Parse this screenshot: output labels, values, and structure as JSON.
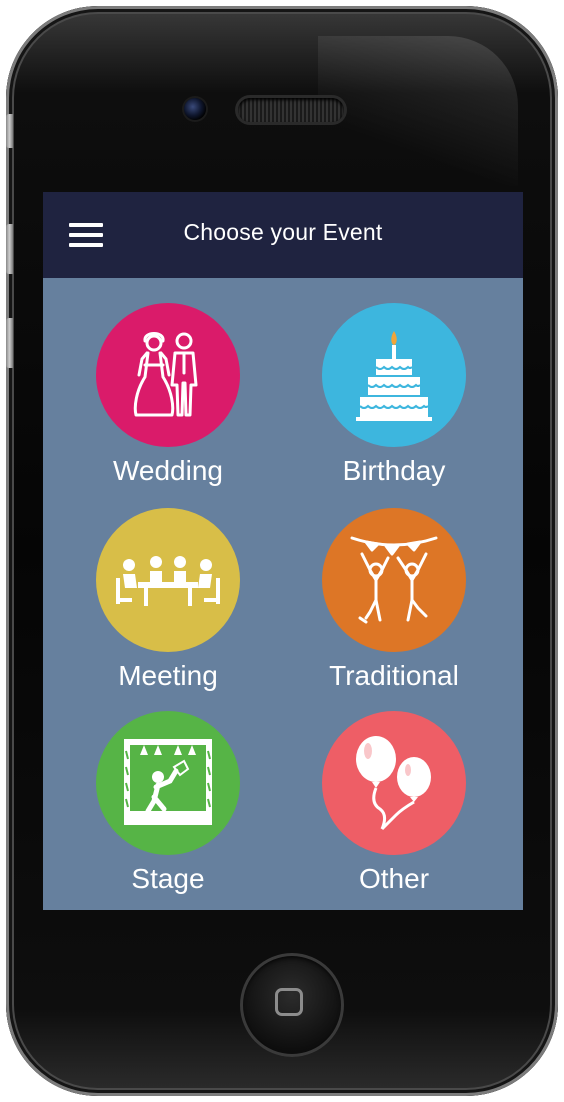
{
  "header": {
    "title": "Choose your Event",
    "menu_icon": "hamburger-menu-icon"
  },
  "events": [
    {
      "label": "Wedding",
      "icon": "wedding-couple-icon",
      "color": "#da1b6a"
    },
    {
      "label": "Birthday",
      "icon": "birthday-cake-icon",
      "color": "#3db6de"
    },
    {
      "label": "Meeting",
      "icon": "meeting-table-icon",
      "color": "#d8be48"
    },
    {
      "label": "Traditional",
      "icon": "traditional-dance-icon",
      "color": "#dd7626"
    },
    {
      "label": "Stage",
      "icon": "stage-performer-icon",
      "color": "#56b446"
    },
    {
      "label": "Other",
      "icon": "balloons-icon",
      "color": "#ee5e66"
    }
  ],
  "colors": {
    "header_bg": "#1f2340",
    "screen_bg": "#66809e",
    "text": "#ffffff"
  },
  "device": {
    "home_icon": "home-button-icon"
  }
}
